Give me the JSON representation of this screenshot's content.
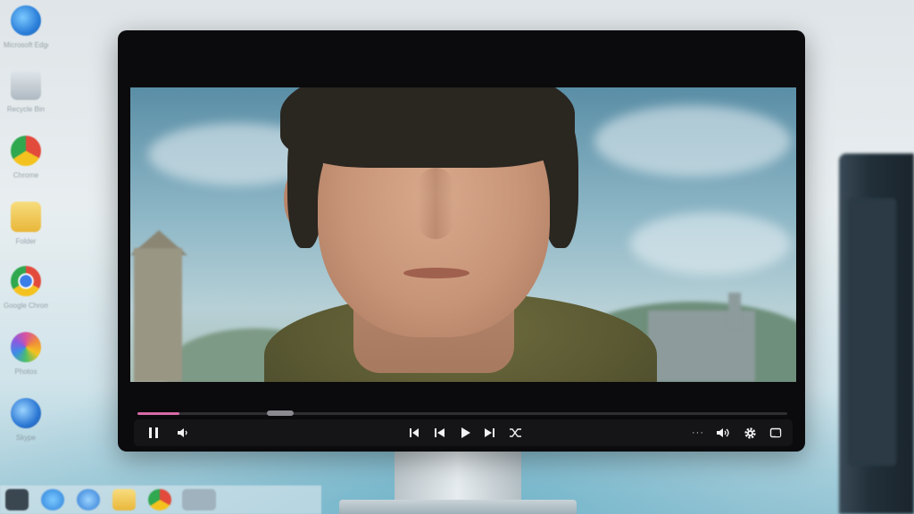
{
  "desktop": {
    "icons": [
      {
        "name": "browser-icon",
        "label": "Microsoft Edge",
        "color": "#2b7fd9"
      },
      {
        "name": "recycle-bin-icon",
        "label": "Recycle Bin",
        "color": "#9aa7b0"
      },
      {
        "name": "app-icon",
        "label": "Chrome",
        "color": "#e24a3b"
      },
      {
        "name": "folder-icon",
        "label": "Folder",
        "color": "#e9c04a"
      },
      {
        "name": "chrome-icon",
        "label": "Google Chrome",
        "color": "#2fa84f"
      },
      {
        "name": "photos-icon",
        "label": "Photos",
        "color": "#d9539f"
      },
      {
        "name": "app-icon-2",
        "label": "Skype",
        "color": "#2c78d4"
      }
    ]
  },
  "player": {
    "progress_fraction": 0.065,
    "scrub_fraction": 0.22,
    "accent": "#d86aa6",
    "controls": {
      "pause": "pause-icon",
      "volume_left": "speaker-icon",
      "skip_back": "skip-back-icon",
      "prev": "previous-icon",
      "play": "play-icon",
      "next": "next-icon",
      "shuffle": "shuffle-icon",
      "more": "···",
      "volume": "volume-icon",
      "settings": "gear-icon",
      "fullscreen": "fullscreen-icon"
    }
  },
  "taskbar": {
    "items": [
      "start-icon",
      "edge-icon",
      "browser-icon",
      "file-explorer-icon",
      "chrome-icon",
      "store-icon"
    ]
  }
}
